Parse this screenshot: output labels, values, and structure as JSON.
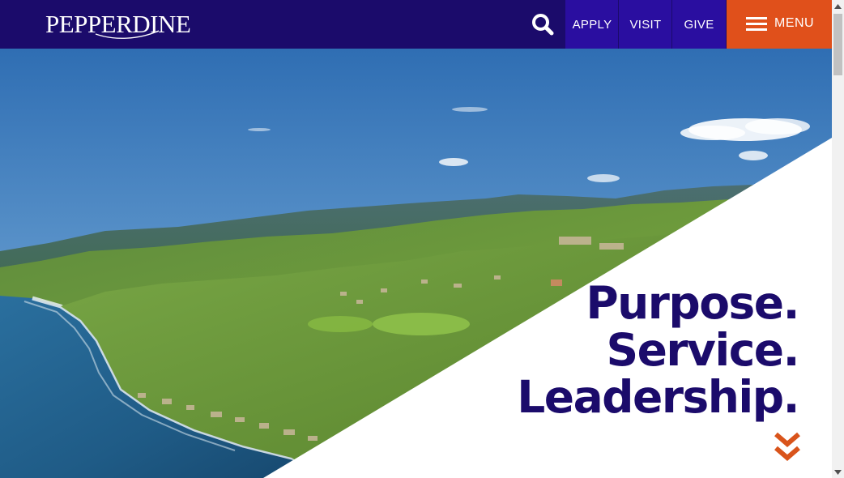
{
  "header": {
    "logo_text": "PEPPERDINE",
    "nav": {
      "apply": "APPLY",
      "visit": "VISIT",
      "give": "GIVE",
      "menu": "MENU"
    },
    "icons": {
      "search": "search-icon",
      "menu": "hamburger-menu-icon"
    }
  },
  "hero": {
    "tagline": [
      "Purpose.",
      "Service.",
      "Leadership."
    ],
    "scroll_icon": "double-chevron-down-icon"
  },
  "colors": {
    "brand_navy": "#1b0b6b",
    "nav_button_blue": "#2a0ea0",
    "accent_orange": "#e0501b"
  }
}
